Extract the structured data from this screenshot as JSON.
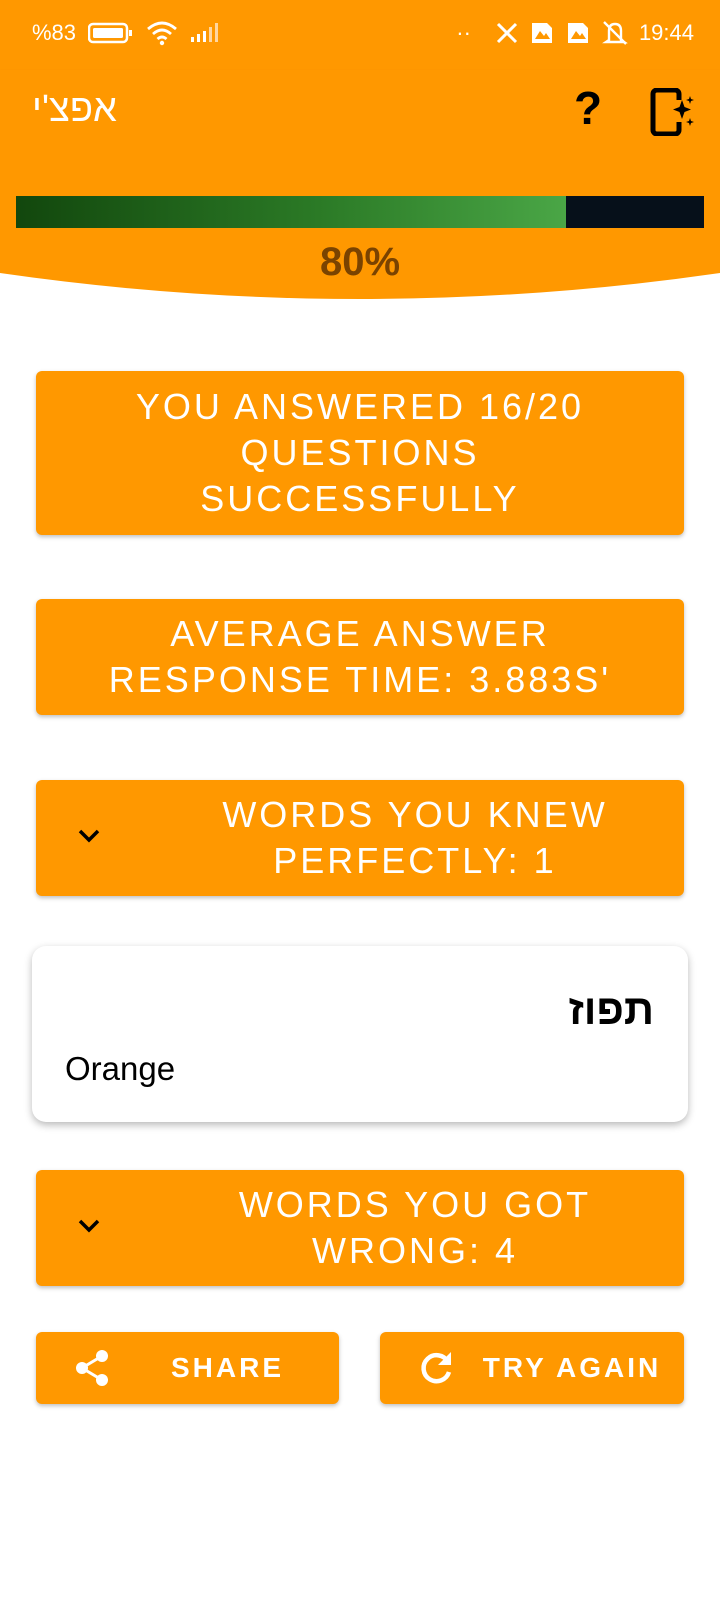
{
  "status_bar": {
    "battery": "%83",
    "time": "19:44",
    "dots": "··"
  },
  "app_bar": {
    "title": "אפצ'י",
    "help_label": "?"
  },
  "progress": {
    "value": 0.8,
    "text": "80%"
  },
  "stats": {
    "answered": "YOU ANSWERED 16/20 QUESTIONS SUCCESSFULLY",
    "average_time": "AVERAGE ANSWER RESPONSE TIME: 3.883S'",
    "knew_perfectly": "WORDS YOU KNEW PERFECTLY: 1",
    "got_wrong": "WORDS YOU GOT WRONG: 4"
  },
  "word_card": {
    "hebrew": "תפוז",
    "english": "Orange"
  },
  "actions": {
    "share": "SHARE",
    "try_again": "TRY AGAIN"
  },
  "colors": {
    "accent": "#FF9800",
    "progress_dark": "#12470d",
    "progress_light": "#4aa646",
    "track": "#06101a"
  },
  "icons": [
    "battery-icon",
    "wifi-icon",
    "signal-icon",
    "x-app-icon",
    "notification-icon",
    "mute-icon",
    "help-icon",
    "device-sparkle-icon",
    "chevron-down-icon",
    "share-icon",
    "refresh-icon"
  ]
}
